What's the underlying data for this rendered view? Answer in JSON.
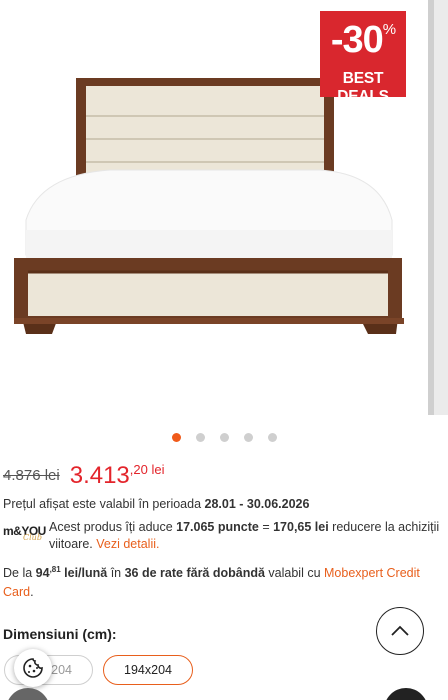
{
  "gallery": {
    "promo_percent": "-30",
    "promo_percent_sign": "%",
    "promo_label": "BEST DEALS",
    "slide_count": 5,
    "active_slide": 1,
    "accent": "#f05a1a",
    "promo_color": "#d9272e"
  },
  "price": {
    "old": "4.876 lei",
    "new_int": "3.413",
    "new_dec": ",20 lei",
    "new_color": "#e3242b"
  },
  "validity": {
    "text_before": "Prețul afișat este valabil în perioada ",
    "period": "28.01 - 30.06.2026"
  },
  "loyalty": {
    "logo_brand": "m&YOU",
    "logo_club": "Club",
    "t1": "Acest produs îți aduce ",
    "points": "17.065 puncte",
    "t2": " = ",
    "value": "170,65 lei",
    "t3": " reducere la achiziții viitoare. ",
    "details_link": "Vezi detalii."
  },
  "rates": {
    "t1": "De la ",
    "amount_int": "94",
    "amount_dec": ",81",
    "per_month": " lei/lună",
    "t2": " în ",
    "rates_count": "36 de rate fără dobândă",
    "t3": " valabil cu ",
    "card_link": "Mobexpert Credit Card",
    "t4": "."
  },
  "dimensions": {
    "label": "Dimensiuni (cm):",
    "options": [
      "204",
      "194x204"
    ],
    "selected": "194x204"
  },
  "icons": {
    "cookie": "cookie-icon",
    "scroll_top": "chevron-up-icon"
  }
}
